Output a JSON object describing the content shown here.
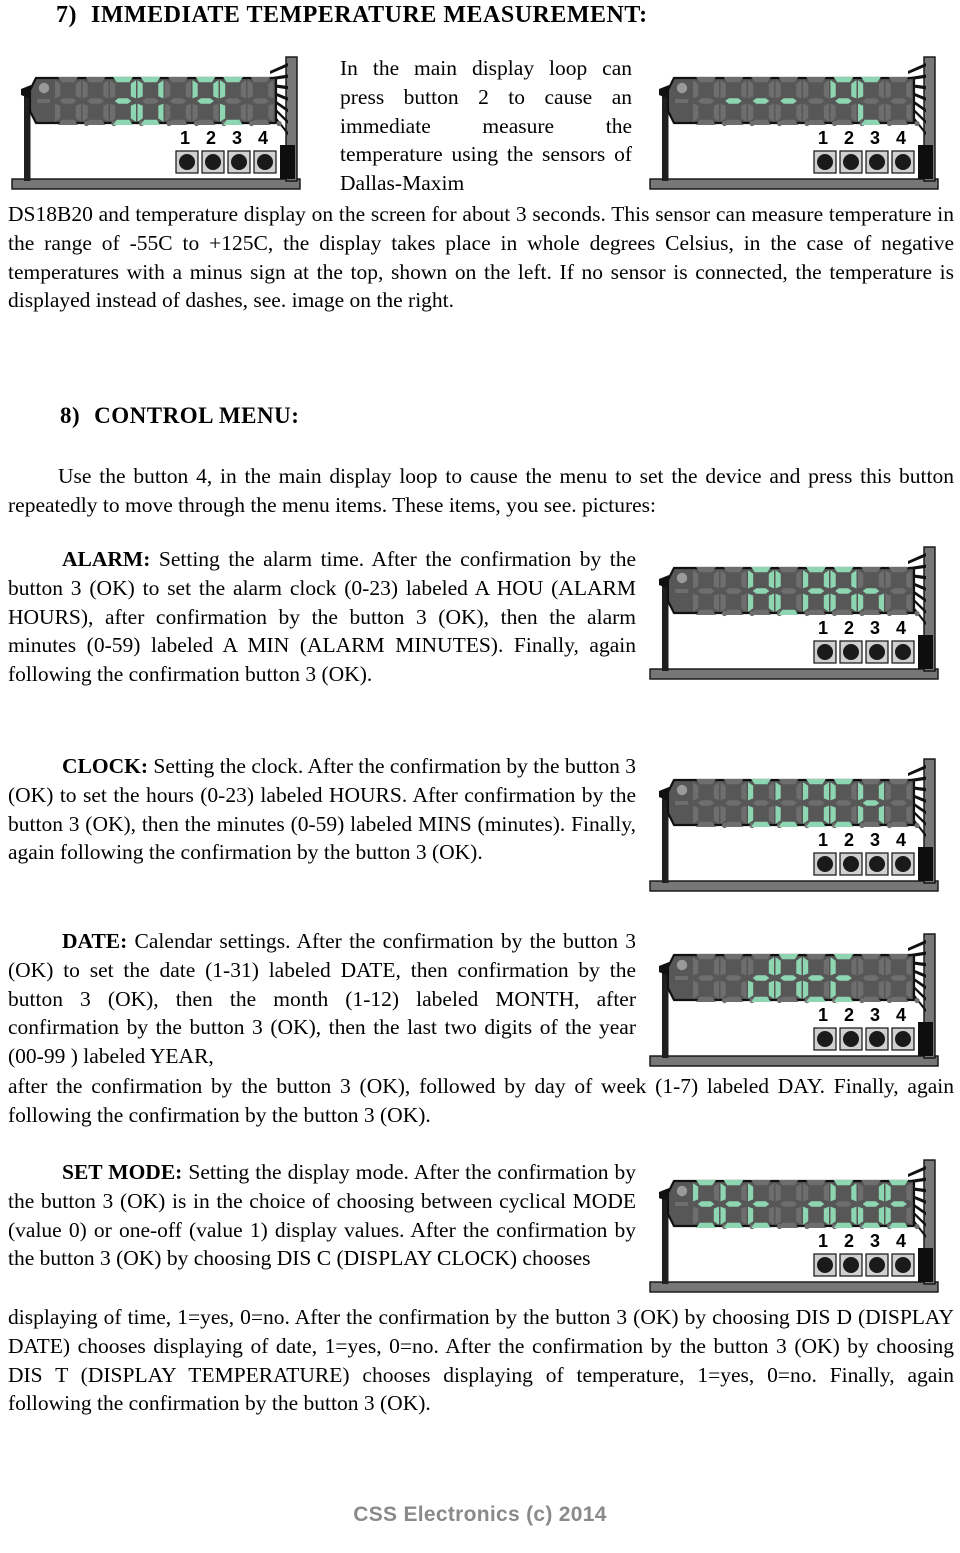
{
  "document": {
    "footer": "CSS Electronics (c) 2014"
  },
  "sections": {
    "temperature": {
      "number": "7)",
      "title": "IMMEDIATE TEMPERATURE MEASUREMENT:",
      "intro": "In the main display loop can press button 2 to cause an immediate measure the temperature using the sensors of Dallas-Maxim",
      "body": "DS18B20 and temperature display on the screen for about 3 seconds. This sensor can measure temperature in the range of -55C to +125C, the display takes place in whole degrees Celsius, in the case of negative temperatures with a minus sign at the top, shown on the left. If no sensor is connected, the temperature is displayed instead of dashes, see. image on the right."
    },
    "control_menu": {
      "number": "8)",
      "title": "CONTROL MENU:",
      "body": "Use the button 4, in the main display loop to cause the menu to set the device and press this button repeatedly to move through the menu items. These items, you see. pictures:"
    },
    "alarm": {
      "label": "ALARM:",
      "body": " Setting the alarm time. After the confirmation by the button 3 (OK) to set the alarm clock (0-23) labeled A HOU (ALARM HOURS), after confirmation by the button 3 (OK), then the alarm minutes (0-59) labeled A MIN (ALARM MINUTES). Finally, again following the confirmation button 3 (OK)."
    },
    "clock": {
      "label": "CLOCK:",
      "body": " Setting the clock. After the confirmation by the button 3 (OK) to set the hours (0-23) labeled HOURS. After confirmation by the button 3 (OK), then the minutes (0-59) labeled MINS (minutes). Finally, again following the confirmation by the button 3 (OK)."
    },
    "date": {
      "label": "DATE:",
      "body": " Calendar settings. After the confirmation by the button 3 (OK) to set the date (1-31) labeled DATE, then confirmation by the button 3 (OK), then the month (1-12) labeled MONTH, after confirmation by the button 3 (OK), then the last two digits of the year (00-99 ) labeled YEAR,",
      "tail": "after the confirmation by the button 3 (OK), followed by day of week (1-7) labeled DAY. Finally, again following the confirmation by the button 3 (OK)."
    },
    "set_mode": {
      "label": "SET MODE:",
      "body": " Setting the display mode. After the confirmation by the button 3 (OK) is in the choice of choosing between cyclical MODE (value 0) or one-off (value 1) display values. After the confirmation by the button 3 (OK) by choosing DIS C (DISPLAY CLOCK) chooses",
      "tail": "displaying of time, 1=yes, 0=no. After the confirmation by the button 3 (OK) by choosing DIS D (DISPLAY DATE) chooses displaying of date, 1=yes, 0=no. After the confirmation by the button 3 (OK) by choosing DIS T (DISPLAY TEMPERATURE) chooses displaying of temperature, 1=yes, 0=no. Finally, again following the confirmation by the button 3 (OK)."
    }
  },
  "colors": {
    "panel_body": "#575757",
    "panel_dark": "#3f3f3f",
    "segment_off": "#6e6e6e",
    "segment_on": "#8ed6b1",
    "frame": "#777777",
    "button_pad": "#d0d0d0",
    "button_dot": "#1a1a1a",
    "footer_text": "#8a8a8a"
  },
  "devices": [
    {
      "id": "device-temperature-reading",
      "caption_digits": "30 °C",
      "digits": [
        "",
        "",
        "3",
        "0",
        "",
        "°",
        "C",
        ""
      ],
      "buttons": [
        "1",
        "2",
        "3",
        "4"
      ]
    },
    {
      "id": "device-temperature-no-sensor",
      "caption_digits": "-- °C",
      "digits": [
        "",
        "-",
        "-",
        "-",
        "",
        "°",
        "C",
        ""
      ],
      "buttons": [
        "1",
        "2",
        "3",
        "4"
      ]
    },
    {
      "id": "device-alarm",
      "caption_digits": "ALARM",
      "digits": [
        "",
        "",
        "A",
        "L",
        "A",
        "R",
        "n",
        ""
      ],
      "buttons": [
        "1",
        "2",
        "3",
        "4"
      ]
    },
    {
      "id": "device-clock",
      "caption_digits": "CLOCH",
      "digits": [
        "",
        "",
        "C",
        "L",
        "O",
        "C",
        "H",
        ""
      ],
      "buttons": [
        "1",
        "2",
        "3",
        "4"
      ]
    },
    {
      "id": "device-date",
      "caption_digits": "dAtE",
      "digits": [
        "",
        "",
        "d",
        "A",
        "t",
        "E",
        "",
        ""
      ],
      "buttons": [
        "1",
        "2",
        "3",
        "4"
      ]
    },
    {
      "id": "device-set-mode",
      "caption_digits": "SEt nOdE",
      "digits": [
        "S",
        "E",
        "t",
        "",
        "n",
        "O",
        "d",
        "E"
      ],
      "buttons": [
        "1",
        "2",
        "3",
        "4"
      ]
    }
  ]
}
